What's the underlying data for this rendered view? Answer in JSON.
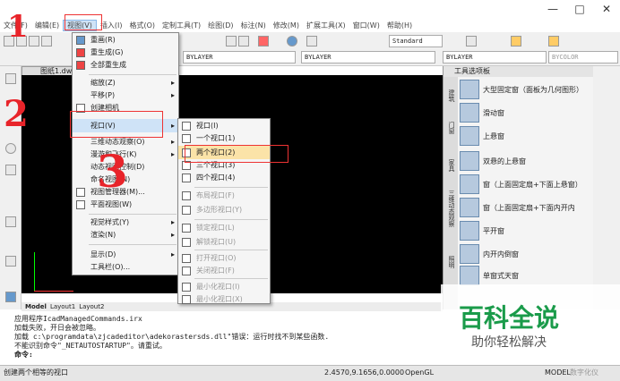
{
  "window": {
    "min": "—",
    "max": "□",
    "close": "✕"
  },
  "menubar": [
    "文件(F)",
    "编辑(E)",
    "视图(V)",
    "插入(I)",
    "格式(O)",
    "定制工具(T)",
    "绘图(D)",
    "标注(N)",
    "修改(M)",
    "扩展工具(X)",
    "窗口(W)",
    "帮助(H)"
  ],
  "toolbar": {
    "textstyle": "Standard",
    "layer": "BYLAYER",
    "linetype": "BYLAYER",
    "lineweight": "BYLAYER",
    "color": "BYCOLOR"
  },
  "document_tab": "图纸1.dwg",
  "layout_tabs": [
    "Model",
    "Layout1",
    "Layout2"
  ],
  "view_menu": [
    "重画(R)",
    "重生成(G)",
    "全部重生成",
    "缩放(Z)",
    "平移(P)",
    "创建相机",
    "视口(V)",
    "三维动态观察(O)",
    "漫游和飞行(K)",
    "动态视图控制(D)",
    "命名视图(N)",
    "视图管理器(M)...",
    "平面视图(W)",
    "视觉样式(Y)",
    "渲染(N)",
    "显示(D)",
    "工具栏(O)..."
  ],
  "viewport_menu": [
    "视口(I)",
    "一个视口(1)",
    "两个视口(2)",
    "三个视口(3)",
    "四个视口(4)",
    "布局视口(F)",
    "多边形视口(Y)",
    "锁定视口(L)",
    "解锁视口(U)",
    "打开视口(O)",
    "关闭视口(F)",
    "最小化视口(I)",
    "最小化视口(X)"
  ],
  "palette": {
    "title": "工具选项板",
    "side_tabs": [
      "建筑",
      "门窗",
      "家具",
      "三维动态观察",
      "建筑",
      "材质",
      "照明"
    ],
    "items": [
      "大型固定窗（面板为几何图形）",
      "滑动窗",
      "上悬窗",
      "双悬的上悬窗",
      "窗（上面固定扇+下面上悬窗）",
      "窗（上面固定扇+下面内开内",
      "平开窗",
      "内开内倒窗",
      "单窗式天窗"
    ]
  },
  "command_lines": [
    "应用程序IcadManagedCommands.irx",
    "加载失败，开日会被忽略。",
    "加载 c:\\programdata\\zjcadeditor\\adekorastersds.dll\"错误：运行时找不到某些函数.",
    "不能识别命令\"_NETAUTOSTARTUP\"。请重试。",
    "命令:"
  ],
  "status": {
    "hint": "创建两个相等的视口",
    "coords": "2.4570,9.1656,0.0000",
    "opengl": "OpenGL",
    "model": "MODEL",
    "snap": "数字化仪"
  },
  "annotations": [
    "1",
    "2",
    "3"
  ],
  "watermark": {
    "title": "百科全说",
    "subtitle": "助你轻松解决"
  }
}
